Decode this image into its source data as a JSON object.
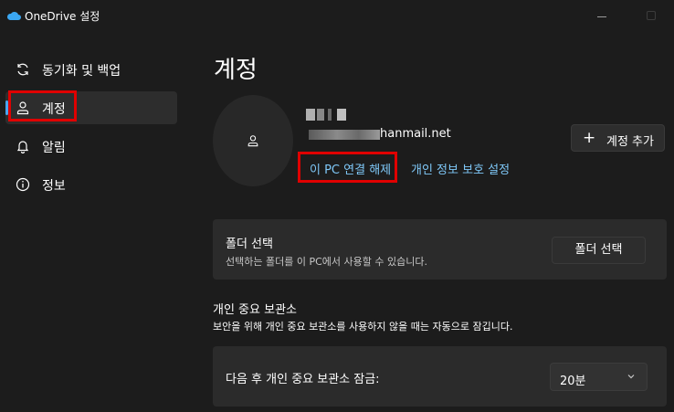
{
  "window": {
    "title": "OneDrive 설정"
  },
  "sidebar": {
    "items": [
      {
        "label": "동기화 및 백업",
        "icon": "sync-icon",
        "selected": false
      },
      {
        "label": "계정",
        "icon": "person-icon",
        "selected": true
      },
      {
        "label": "알림",
        "icon": "bell-icon",
        "selected": false
      },
      {
        "label": "정보",
        "icon": "info-icon",
        "selected": false
      }
    ]
  },
  "main": {
    "title": "계정",
    "account": {
      "email_visible": "hanmail.net",
      "unlink_label": "이 PC 연결 해제",
      "privacy_label": "개인 정보 보호 설정",
      "add_account_label": "계정 추가"
    },
    "folder_card": {
      "title": "폴더 선택",
      "subtitle": "선택하는 폴더를 이 PC에서 사용할 수 있습니다.",
      "button_label": "폴더 선택"
    },
    "vault": {
      "title": "개인 중요 보관소",
      "description": "보안을 위해 개인 중요 보관소를 사용하지 않을 때는 자동으로 잠깁니다.",
      "lock_label": "다음 후 개인 중요 보관소 잠금:",
      "lock_value": "20분"
    }
  },
  "colors": {
    "background": "#1c1c1c",
    "card": "#2b2b2b",
    "accent": "#4aa5f0",
    "link": "#7fc8f8",
    "highlight": "#e00000"
  }
}
